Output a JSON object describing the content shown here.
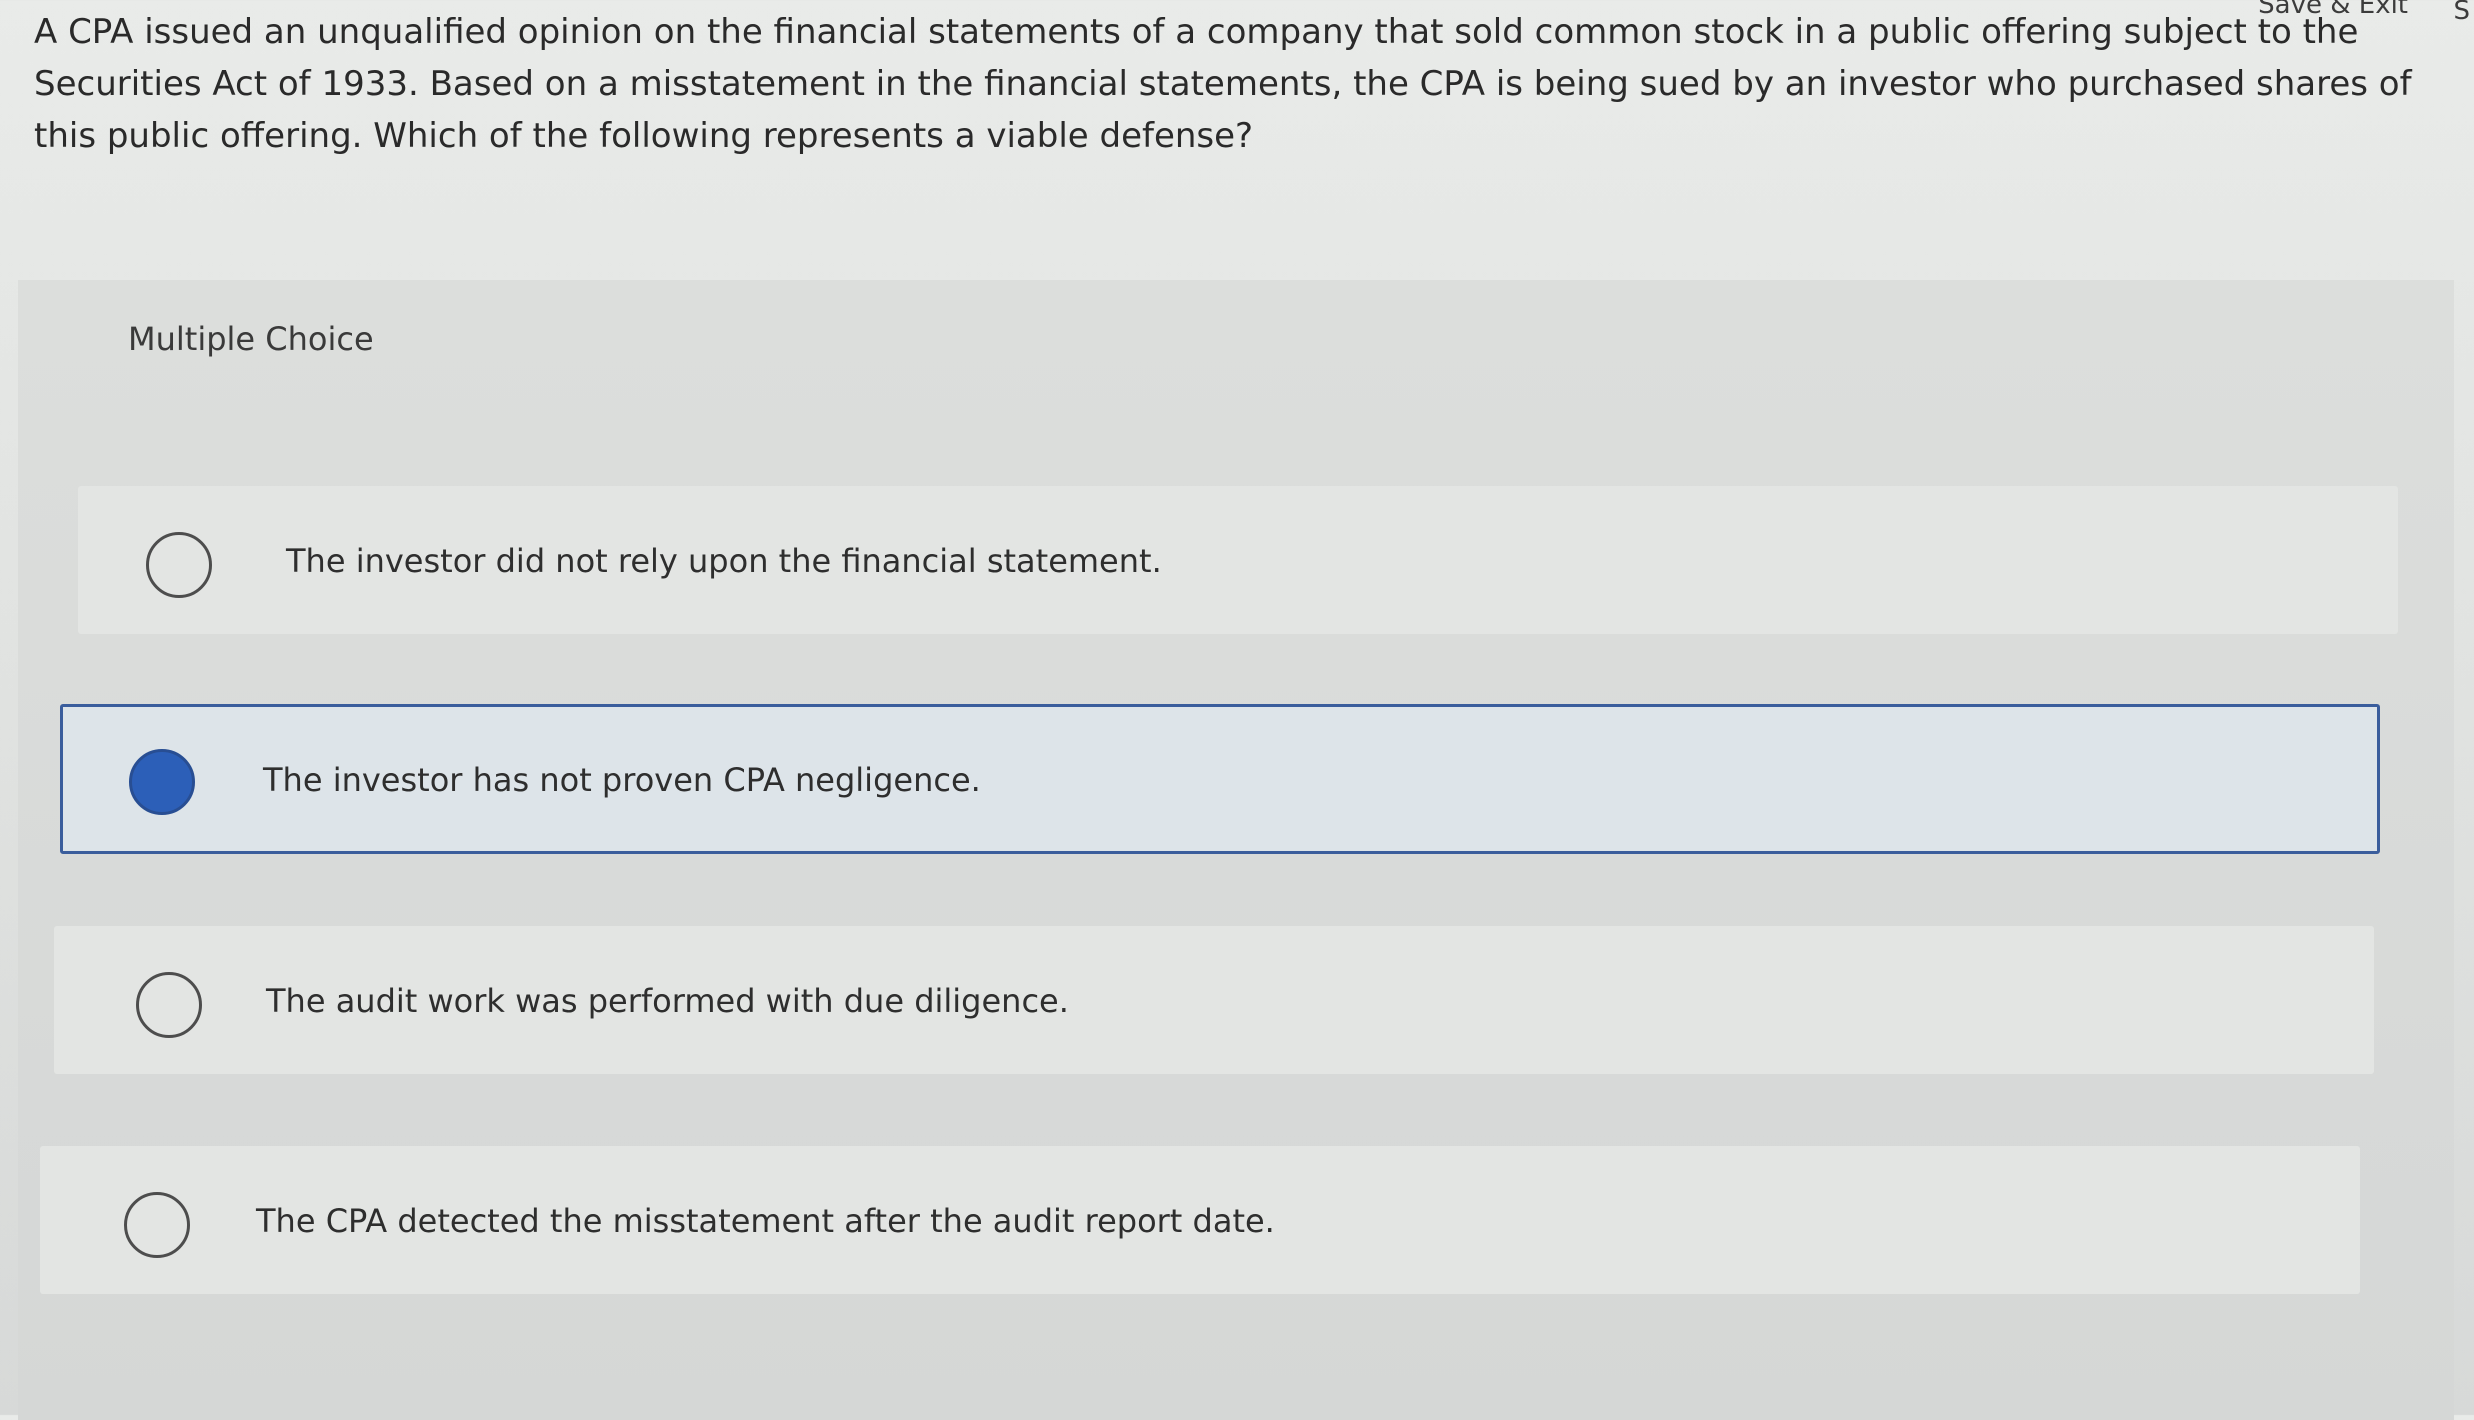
{
  "header": {
    "save_exit_label": "Save & Exit",
    "cutoff_label": "S"
  },
  "question": {
    "text": "A CPA issued an unqualified opinion on the financial statements of a company that sold common stock in a public offering subject to the Securities Act of 1933. Based on a misstatement in the financial statements, the CPA is being sued by an investor who purchased shares of this public offering. Which of the following represents a viable defense?"
  },
  "answer_panel": {
    "label": "Multiple Choice",
    "options": [
      {
        "text": "The investor did not rely upon the financial statement.",
        "selected": false
      },
      {
        "text": "The investor has not proven CPA negligence.",
        "selected": true
      },
      {
        "text": "The audit work was performed with due diligence.",
        "selected": false
      },
      {
        "text": "The CPA detected the misstatement after the audit report date.",
        "selected": false
      }
    ]
  },
  "colors": {
    "selected_fill": "#2c5fb8",
    "selected_border": "#3a5d9c",
    "selected_background": "#dde4e9"
  }
}
